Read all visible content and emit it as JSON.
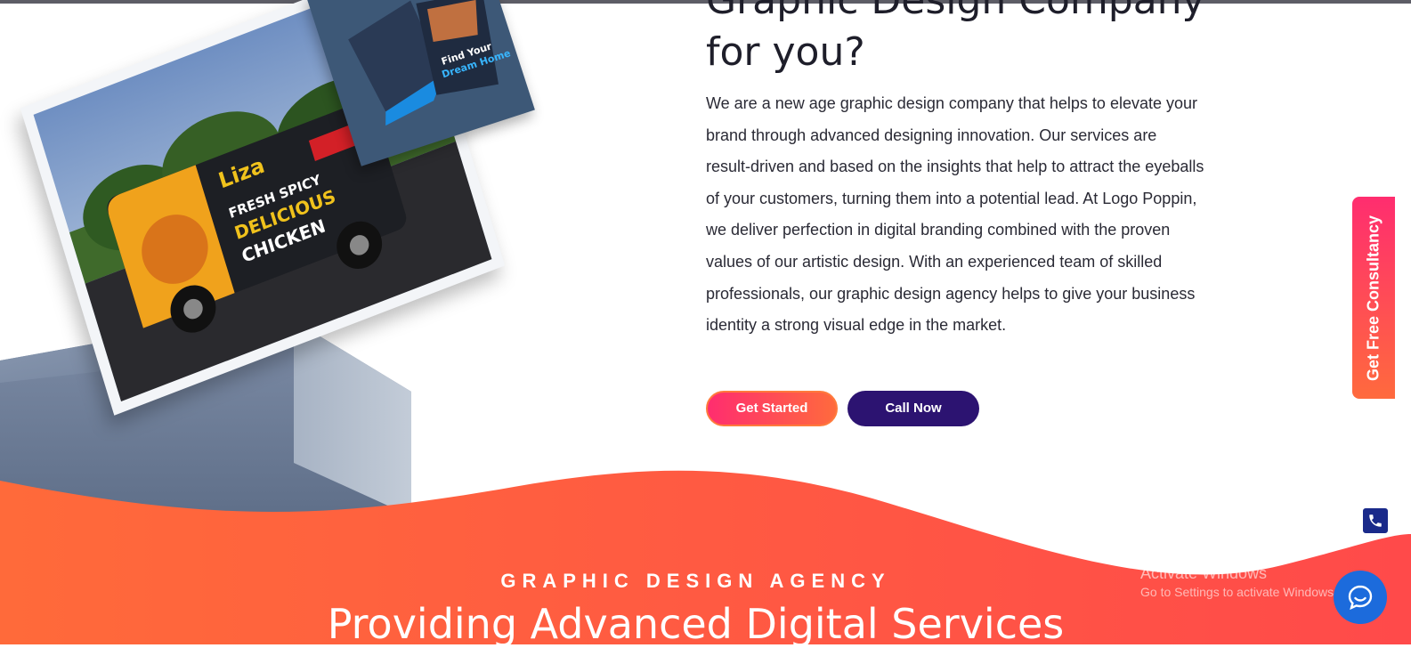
{
  "hero": {
    "headline_line1": "Graphic Design Company",
    "headline_line2": "for you?",
    "intro": "We are a new age graphic design company that helps to elevate your brand through advanced designing innovation. Our services are result-driven and based on the insights that help to attract the eyeballs of your customers, turning them into a potential lead. At Logo Poppin, we deliver perfection in digital branding combined with the proven values of our artistic design. With an experienced team of skilled professionals, our graphic design agency helps to give your business identity a strong visual edge in the market.",
    "get_started_label": "Get Started",
    "call_now_label": "Call Now",
    "van_brand": "Liza",
    "van_tagline_1": "FRESH SPICY",
    "van_tagline_2": "DELICIOUS",
    "van_tagline_3": "CHICKEN",
    "brochure_text_1": "Find Your",
    "brochure_text_2": "Dream Home"
  },
  "section": {
    "eyebrow": "GRAPHIC DESIGN AGENCY",
    "title": "Providing Advanced Digital Services"
  },
  "side_tab": {
    "label": "Get Free Consultancy"
  },
  "widgets": {
    "phone_icon": "phone-icon",
    "chat_icon": "chat-bubble-icon"
  },
  "os_overlay": {
    "title": "Activate Windows",
    "subtitle": "Go to Settings to activate Windows."
  },
  "colors": {
    "accent_pink": "#ff2d6f",
    "accent_orange": "#ff6a3d",
    "call_purple": "#2c1371",
    "chat_blue": "#1c6bdc"
  }
}
